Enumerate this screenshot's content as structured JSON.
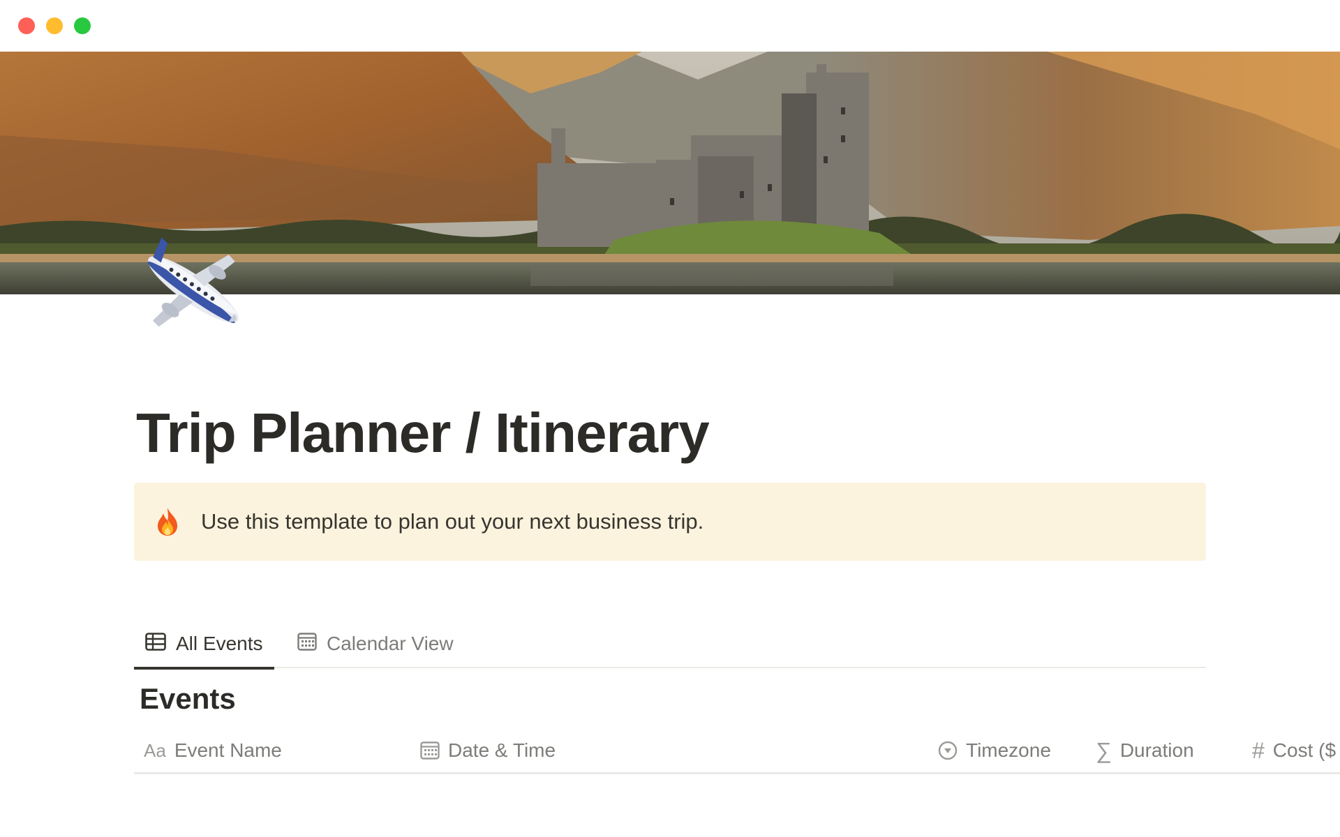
{
  "window": {
    "traffic_lights": [
      "close",
      "minimize",
      "maximize"
    ],
    "colors": {
      "close": "#fe5f57",
      "minimize": "#febc2e",
      "maximize": "#28c840"
    }
  },
  "cover": {
    "icon": "castle-landscape-cover-image"
  },
  "page": {
    "icon": "airplane-emoji",
    "title": "Trip Planner / Itinerary"
  },
  "callout": {
    "icon": "fire-emoji",
    "text": "Use this template to plan out your next business trip.",
    "background": "#fbf3de"
  },
  "views": {
    "tabs": [
      {
        "label": "All Events",
        "icon": "table-icon",
        "active": true
      },
      {
        "label": "Calendar View",
        "icon": "calendar-icon",
        "active": false
      }
    ]
  },
  "database": {
    "title": "Events",
    "columns": [
      {
        "label": "Event Name",
        "icon": "Aa"
      },
      {
        "label": "Date & Time",
        "icon": "calendar-icon"
      },
      {
        "label": "Timezone",
        "icon": "select-icon"
      },
      {
        "label": "Duration",
        "icon": "sigma-icon"
      },
      {
        "label": "Cost ($",
        "icon": "hash-icon"
      }
    ]
  }
}
